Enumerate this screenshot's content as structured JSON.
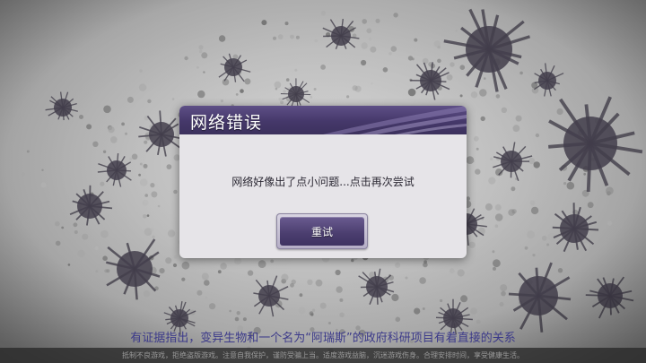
{
  "dialog": {
    "title": "网络错误",
    "message": "网络好像出了点小问题...点击再次尝试",
    "retry_label": "重试"
  },
  "loading_tip": "有证据指出，变异生物和一个名为“阿瑞斯”的政府科研项目有着直接的关系",
  "health_notice": "抵制不良游戏，拒绝盗版游戏。注意自我保护，谨防受骗上当。适度游戏益脑，沉迷游戏伤身。合理安排时间，享受健康生活。",
  "colors": {
    "header_purple": "#45386a",
    "tip_text": "#3c3a8a",
    "modal_body": "#e6e4e8"
  },
  "icons": {
    "background": "virus-particles-art"
  }
}
